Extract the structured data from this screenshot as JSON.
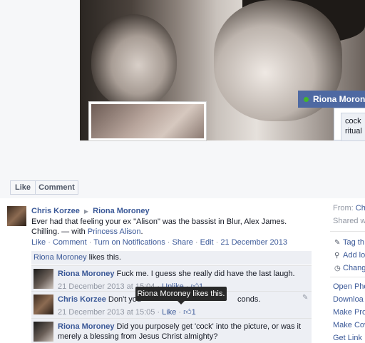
{
  "photo": {
    "tag_name": "Riona Moroney",
    "tag_text_line1": "cock",
    "tag_text_line2": "ritual"
  },
  "buttons": {
    "like": "Like",
    "comment": "Comment"
  },
  "post": {
    "author": "Chris Korzee",
    "arrow": "▶",
    "target": "Riona Moroney",
    "body_main": "Ever had that feeling your ex \"Alison\" was the bassist in Blur, Alex James. Chilling. — with ",
    "tagged": "Princess Alison",
    "body_end": ".",
    "actions": {
      "like": "Like",
      "comment": "Comment",
      "notifications": "Turn on Notifications",
      "share": "Share",
      "edit": "Edit",
      "date": "21 December 2013",
      "sep": " · "
    },
    "likes_name": "Riona Moroney",
    "likes_suffix": " likes this."
  },
  "comments": [
    {
      "name": "Riona Moroney",
      "text": " Fuck me. I guess she really did have the last laugh.",
      "date": "21 December 2013 at 15:04",
      "action": "Unlike",
      "likes": "1"
    },
    {
      "name": "Chris Korzee",
      "text": " Don't you",
      "text_tail": "conds.",
      "date": "21 December 2013 at 15:05",
      "action": "Like",
      "likes": "1"
    },
    {
      "name": "Riona Moroney",
      "text": " Did you purposely get 'cock' into the picture, or was it merely a blessing from Jesus Christ almighty?"
    }
  ],
  "tooltip": "Riona Moroney likes this.",
  "sidebar": {
    "from_label": "From: ",
    "from_name": "Ch",
    "shared": "Shared w",
    "actions": [
      {
        "icon": "tag-icon",
        "glyph": "✎",
        "label": "Tag th"
      },
      {
        "icon": "location-icon",
        "glyph": "⚲",
        "label": "Add lo"
      },
      {
        "icon": "calendar-icon",
        "glyph": "◷",
        "label": "Chang"
      }
    ],
    "links": [
      "Open Pho",
      "Downloa",
      "Make Prof",
      "Make Cov",
      "Get Link"
    ]
  },
  "colors": {
    "link": "#3b5998",
    "tag_bar": "#4e69a2",
    "online_dot": "#42b72a",
    "comment_bg": "#edeff4",
    "tooltip_bg": "#282828"
  }
}
